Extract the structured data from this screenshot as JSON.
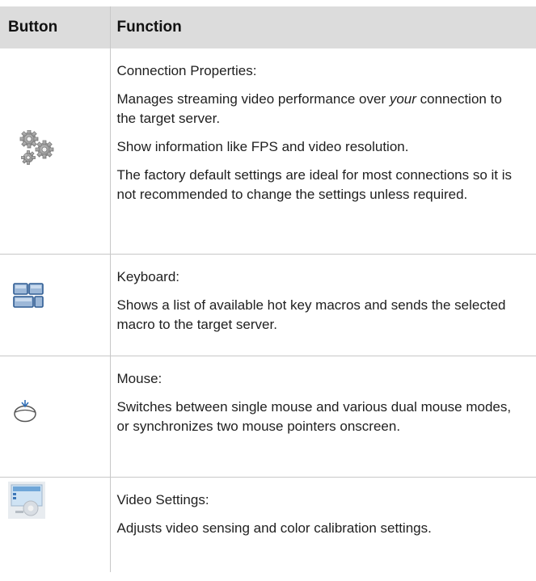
{
  "table": {
    "headers": {
      "button": "Button",
      "function": "Function"
    },
    "rows": [
      {
        "icon": "gears-icon",
        "title": "Connection Properties:",
        "desc_pre": "Manages streaming video performance over ",
        "desc_em": "your",
        "desc_post": " connection to the target server.",
        "info": "Show information like FPS and video resolution.",
        "note": "The factory default settings are ideal for most connections so it is not recommended to change the settings unless required."
      },
      {
        "icon": "keyboard-icon",
        "title": "Keyboard:",
        "desc": "Shows a list of available hot key macros and sends the selected macro to the target server."
      },
      {
        "icon": "mouse-icon",
        "title": "Mouse:",
        "desc": "Switches between single mouse and various dual mouse modes, or synchronizes two mouse pointers onscreen."
      },
      {
        "icon": "video-settings-icon",
        "title": "Video Settings:",
        "desc": "Adjusts video sensing and color calibration settings."
      }
    ]
  }
}
